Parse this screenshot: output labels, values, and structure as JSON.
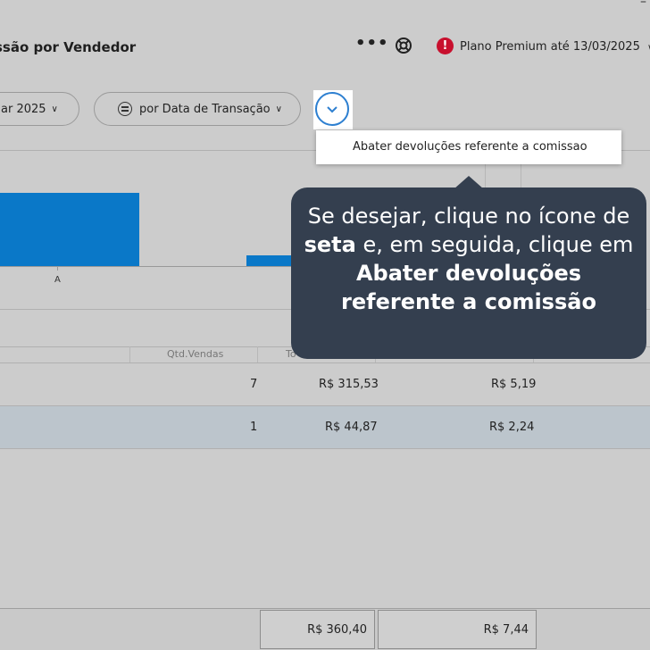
{
  "header": {
    "title": "ssão por Vendedor",
    "window_control": "–",
    "more_label": "•••",
    "plan_alert_symbol": "!",
    "plan_label": "Plano Premium até 13/03/2025",
    "plan_chevron": "⌄"
  },
  "filters": {
    "date_label": "ar 2025",
    "transaction_label": "por Data de Transação",
    "chevron": "⌄"
  },
  "dropdown": {
    "menu_item": "Abater devoluções referente a comissao"
  },
  "chart": {
    "x_label": "A"
  },
  "chart_data": {
    "type": "bar",
    "categories": [
      "A",
      ""
    ],
    "values": [
      7,
      1
    ]
  },
  "table": {
    "headers": {
      "qtd_vendas": "Qtd.Vendas",
      "total_partial": "To"
    },
    "rows": [
      {
        "qtd": "7",
        "total": "R$ 315,53",
        "comissao": "R$ 5,19"
      },
      {
        "qtd": "1",
        "total": "R$ 44,87",
        "comissao": "R$ 2,24"
      }
    ],
    "totals": {
      "total": "R$ 360,40",
      "comissao": "R$ 7,44"
    }
  },
  "tooltip": {
    "part1": "Se desejar, clique no ícone de ",
    "bold1": "seta",
    "part2": " e, em seguida, clique em ",
    "bold2": "Abater devoluções referente a comissão"
  },
  "colors": {
    "bar": "#0a78c8",
    "accent": "#2d7fd0",
    "alert": "#c8102e",
    "tooltip_bg": "#343f4f",
    "selected_row": "#bcc5cc"
  }
}
